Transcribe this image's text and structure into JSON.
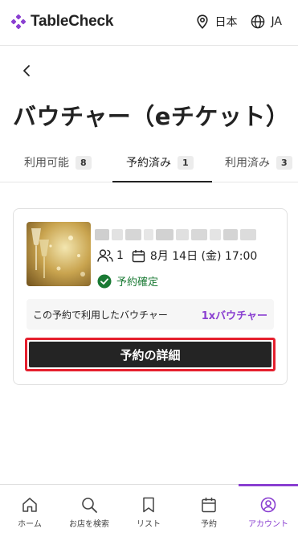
{
  "colors": {
    "accent": "#8a3fd1",
    "success": "#1a7a34",
    "button_bg": "#242424",
    "highlight_border": "#e5202e"
  },
  "header": {
    "logo_text": "TableCheck",
    "region": "日本",
    "language": "JA"
  },
  "page": {
    "title": "バウチャー（eチケット）"
  },
  "tabs": [
    {
      "label": "利用可能",
      "count": "8"
    },
    {
      "label": "予約済み",
      "count": "1"
    },
    {
      "label": "利用済み",
      "count": "3"
    }
  ],
  "booking": {
    "guests": "1",
    "date": "8月 14日 (金) 17:00",
    "status": "予約確定",
    "voucher_label": "この予約で利用したバウチャー",
    "voucher_count": "1xバウチャー",
    "detail_button": "予約の詳細"
  },
  "bottom_nav": [
    {
      "label": "ホーム",
      "icon": "home-icon"
    },
    {
      "label": "お店を検索",
      "icon": "search-icon"
    },
    {
      "label": "リスト",
      "icon": "bookmark-icon"
    },
    {
      "label": "予約",
      "icon": "calendar-icon"
    },
    {
      "label": "アカウント",
      "icon": "account-icon"
    }
  ]
}
